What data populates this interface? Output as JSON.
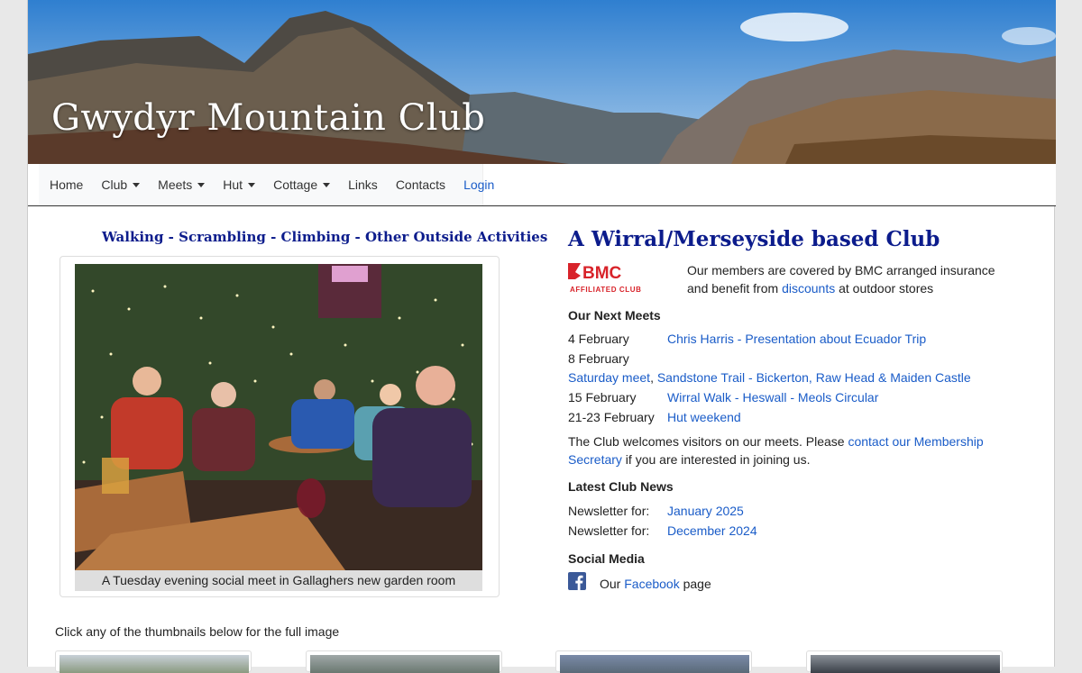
{
  "header": {
    "site_title": "Gwydyr Mountain Club"
  },
  "nav": {
    "items": [
      {
        "label": "Home",
        "dropdown": false
      },
      {
        "label": "Club",
        "dropdown": true
      },
      {
        "label": "Meets",
        "dropdown": true
      },
      {
        "label": "Hut",
        "dropdown": true
      },
      {
        "label": "Cottage",
        "dropdown": true
      },
      {
        "label": "Links",
        "dropdown": false
      },
      {
        "label": "Contacts",
        "dropdown": false
      },
      {
        "label": "Login",
        "dropdown": false
      }
    ]
  },
  "left": {
    "tagline": "Walking - Scrambling - Climbing - Other Outside Activities",
    "photo_caption": "A Tuesday evening social meet in Gallaghers new garden room"
  },
  "right": {
    "title": "A Wirral/Merseyside based Club",
    "bmc_logo_text": "BMC",
    "bmc_logo_sub": "AFFILIATED CLUB",
    "bmc_text_before": "Our members are covered by BMC arranged insurance and benefit from ",
    "bmc_link": "discounts",
    "bmc_text_after": " at outdoor stores",
    "meets_heading": "Our Next Meets",
    "meets": [
      {
        "date": "4 February",
        "title": "Chris Harris - Presentation about Ecuador Trip"
      },
      {
        "date": "8 February",
        "title": ""
      },
      {
        "date": "15 February",
        "title": "Wirral Walk - Heswall - Meols Circular"
      },
      {
        "date": "21-23 February",
        "title": "Hut weekend"
      }
    ],
    "saturday_meet": "Saturday meet",
    "saturday_sep": ", ",
    "saturday_detail": "Sandstone Trail - Bickerton, Raw Head & Maiden Castle",
    "visitors_before": "The Club welcomes visitors on our meets. Please ",
    "visitors_link": "contact our Membership Secretary",
    "visitors_after": " if you are interested in joining us.",
    "news_heading": "Latest Club News",
    "news": [
      {
        "label": "Newsletter for:",
        "link": "January 2025"
      },
      {
        "label": "Newsletter for:",
        "link": "December 2024"
      }
    ],
    "social_heading": "Social Media",
    "social_before": "Our ",
    "social_link": "Facebook",
    "social_after": " page"
  },
  "thumbs": {
    "label": "Click any of the thumbnails below for the full image"
  },
  "colors": {
    "link": "#1a5cc8",
    "heading_blue": "#0c1c8c",
    "bmc_red": "#d8232a"
  }
}
